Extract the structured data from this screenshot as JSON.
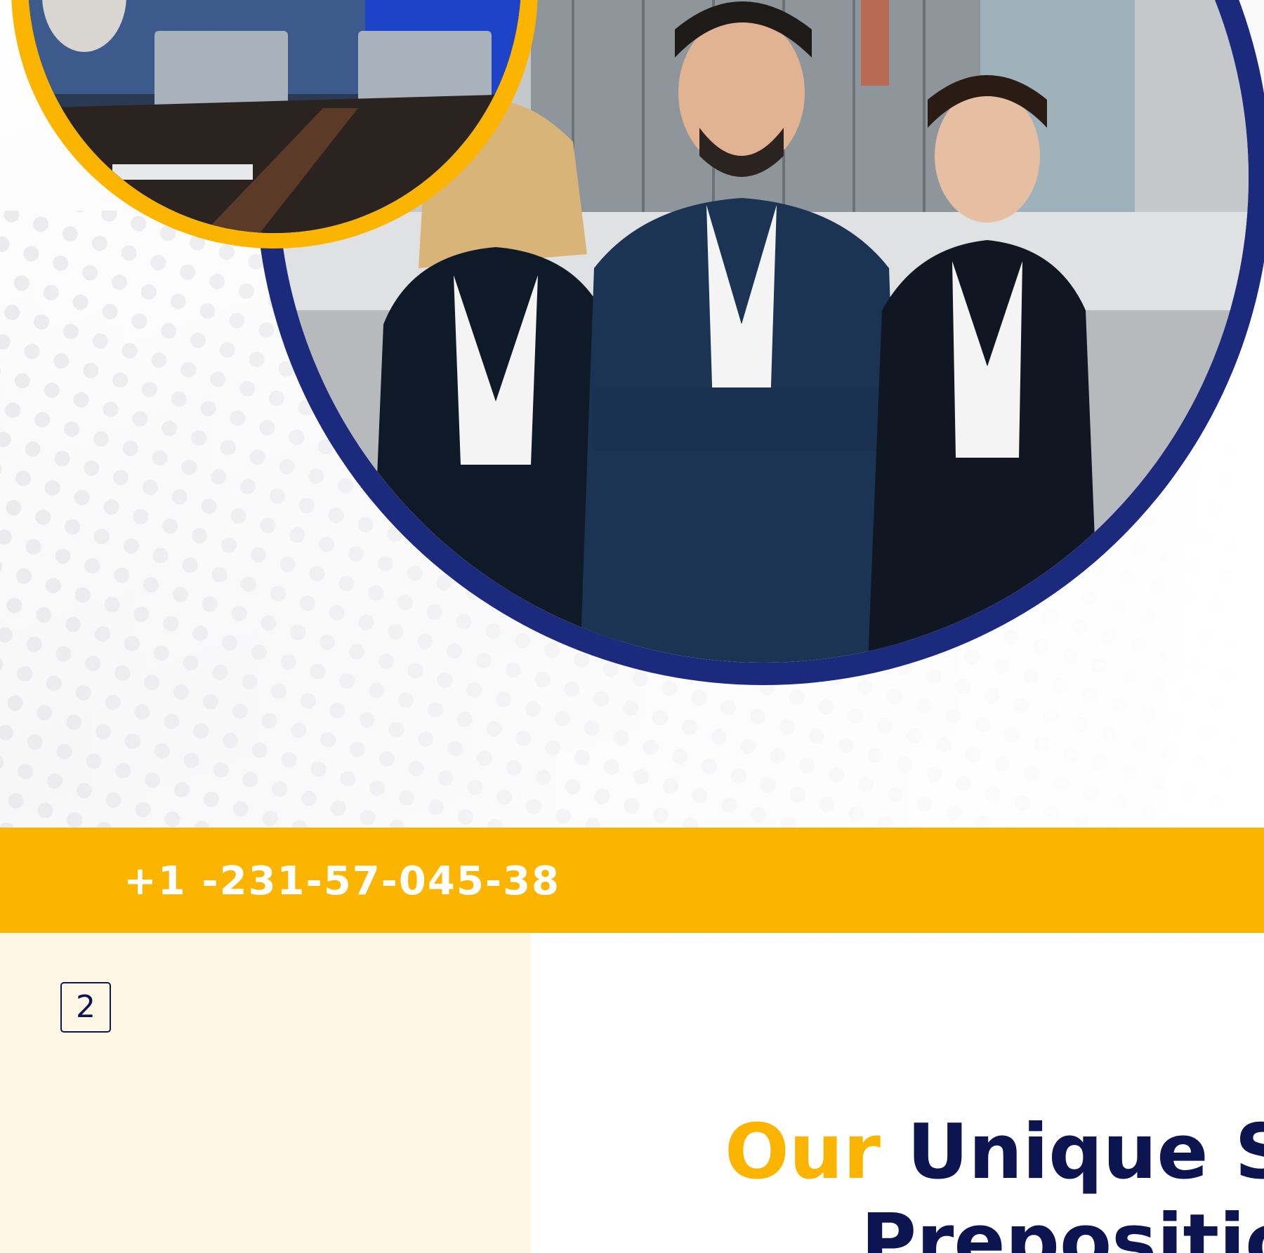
{
  "contact": {
    "phone": "+1 -231-57-045-38"
  },
  "page": {
    "number": "2"
  },
  "headline": {
    "accent": "Our",
    "line1_rest": " Unique Se",
    "line2": "Preposition"
  },
  "colors": {
    "accent": "#fbb400",
    "navy": "#0c1550",
    "ring_blue": "#1b2a7c",
    "cream": "#fff7e6"
  },
  "images": {
    "hero_photo": "three-business-people-photo",
    "meeting_photo": "team-meeting-photo"
  }
}
